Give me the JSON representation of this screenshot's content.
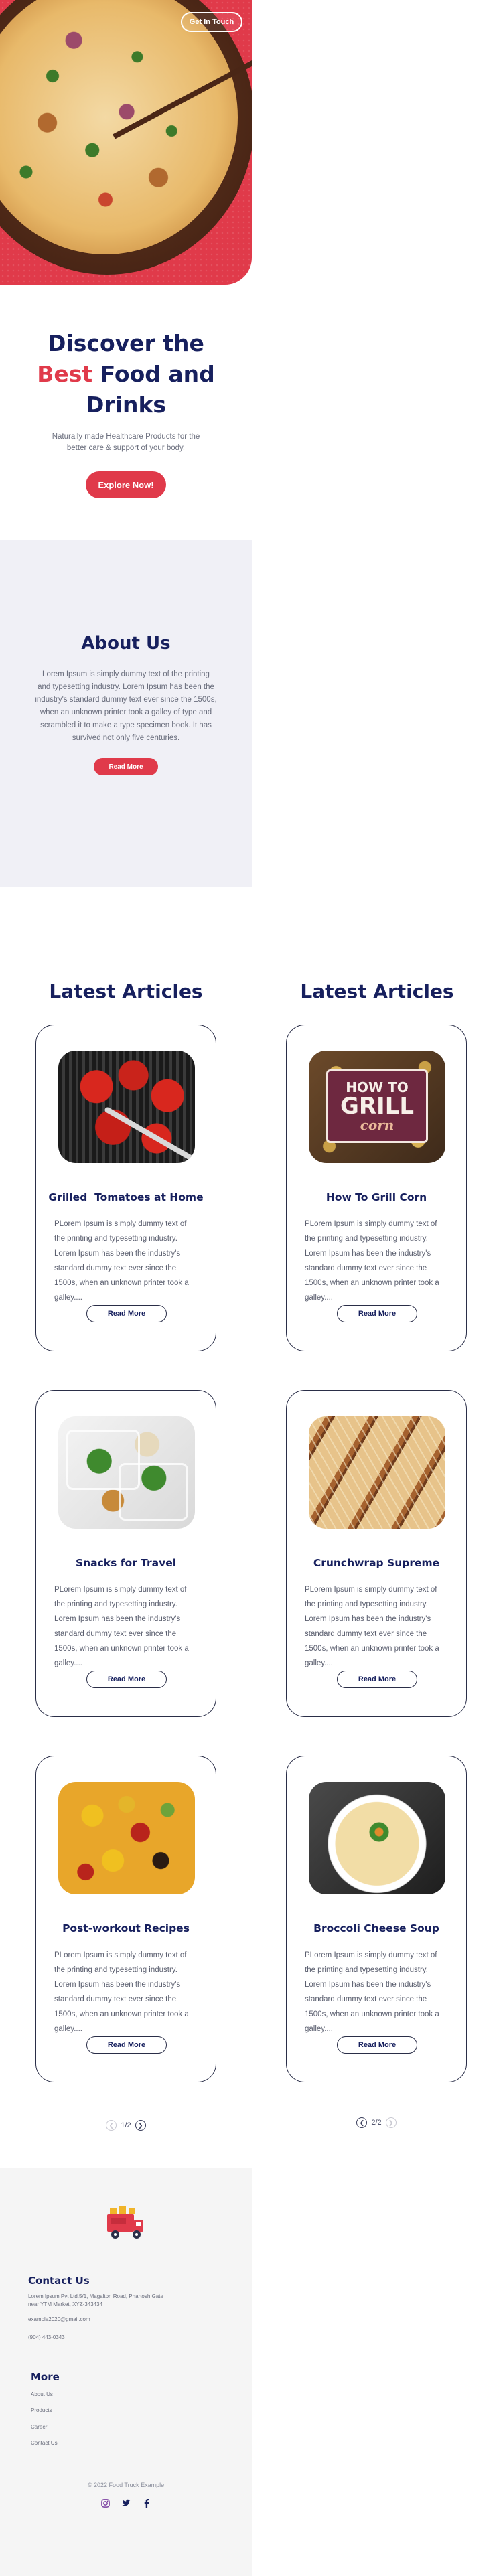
{
  "hero": {
    "get_in_touch": "Get In Touch",
    "title_line1": "Discover the",
    "title_accent": "Best",
    "title_line2_rest": " Food and",
    "title_line3": "Drinks",
    "subtitle": "Naturally made Healthcare Products for the better care & support of your body.",
    "cta": "Explore Now!"
  },
  "about": {
    "title": "About Us",
    "text": "Lorem Ipsum is simply dummy text of the printing and typesetting industry. Lorem Ipsum has been the industry's standard dummy text ever since the 1500s, when an unknown printer took a galley of type and scrambled it to make a type specimen book. It has survived not only five centuries.",
    "button": "Read More"
  },
  "articles": {
    "heading": "Latest Articles",
    "read_more": "Read More",
    "columns": [
      {
        "heading": "Latest Articles",
        "items": [
          {
            "title": "Grilled  Tomatoes at Home",
            "text": "PLorem Ipsum is simply dummy text of the printing and typesetting industry. Lorem Ipsum has been the industry's standard dummy text ever since the 1500s, when an unknown printer took a galley....",
            "image": "grilled-tomatoes-image"
          },
          {
            "title": "Snacks for Travel",
            "text": "PLorem Ipsum is simply dummy text of the printing and typesetting industry. Lorem Ipsum has been the industry's standard dummy text ever since the 1500s, when an unknown printer took a galley....",
            "image": "meal-prep-containers-image"
          },
          {
            "title": "Post-workout Recipes",
            "text": "PLorem Ipsum is simply dummy text of the printing and typesetting industry. Lorem Ipsum has been the industry's standard dummy text ever since the 1500s, when an unknown printer took a galley....",
            "image": "fruit-bowl-image"
          }
        ],
        "pager": {
          "label": "1/2",
          "prev_icon": "chevron-left-icon",
          "next_icon": "chevron-right-icon"
        }
      },
      {
        "heading": "Latest Articles",
        "items": [
          {
            "title": "How To Grill Corn",
            "text": "PLorem Ipsum is simply dummy text of the printing and typesetting industry. Lorem Ipsum has been the industry's standard dummy text ever since the 1500s, when an unknown printer took a galley....",
            "image": "grill-corn-image",
            "sign": {
              "l1": "HOW TO",
              "l2": "GRILL",
              "l3": "corn"
            }
          },
          {
            "title": "Crunchwrap Supreme",
            "text": "PLorem Ipsum is simply dummy text of the printing and typesetting industry. Lorem Ipsum has been the industry's standard dummy text ever since the 1500s, when an unknown printer took a galley....",
            "image": "crunchwrap-image"
          },
          {
            "title": "Broccoli Cheese Soup",
            "text": "PLorem Ipsum is simply dummy text of the printing and typesetting industry. Lorem Ipsum has been the industry's standard dummy text ever since the 1500s, when an unknown printer took a galley....",
            "image": "broccoli-soup-image"
          }
        ],
        "pager": {
          "label": "2/2",
          "prev_icon": "chevron-left-icon",
          "next_icon": "chevron-right-icon"
        }
      }
    ]
  },
  "footer": {
    "logo_icon": "food-truck-icon",
    "contact_title": "Contact Us",
    "address": "Lorem Ipsum Pvt Ltd.5/1, Magalton Road, Phartosh Gate near YTM Market, XYZ-343434",
    "email": "example2020@gmail.com",
    "phone": "(904) 443-0343",
    "more_title": "More",
    "links": [
      "About Us",
      "Products",
      "Career",
      "Contact Us"
    ],
    "copyright": "© 2022 Food Truck Example",
    "social": [
      "instagram-icon",
      "twitter-icon",
      "facebook-icon"
    ]
  },
  "colors": {
    "accent": "#e03a4a",
    "navy": "#17205e",
    "about_bg": "#f0f0f6",
    "footer_bg": "#f5f5f5"
  }
}
